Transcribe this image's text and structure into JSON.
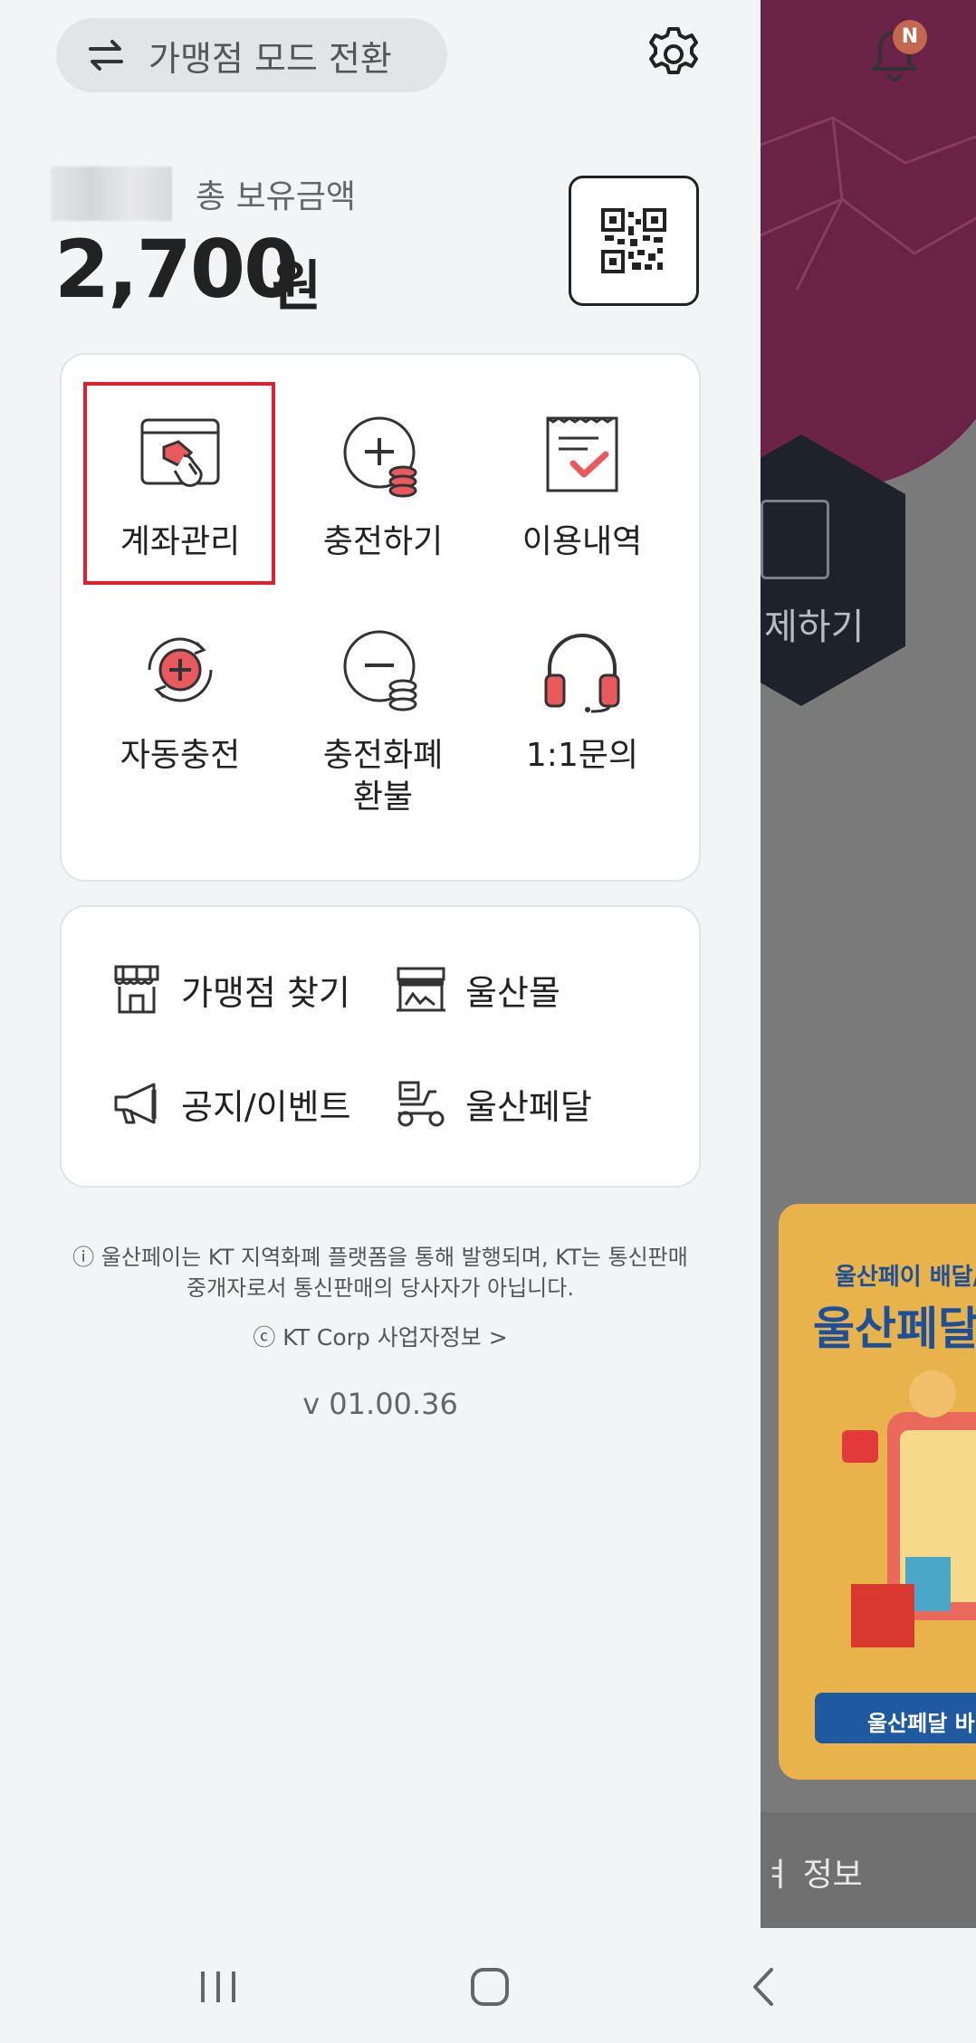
{
  "drawer": {
    "mode_switch_label": "가맹점 모드 전환",
    "asset": {
      "label": "총 보유금액",
      "amount": "2,700",
      "unit": "원"
    },
    "menu": [
      {
        "label": "계좌관리",
        "icon": "account-manage-icon"
      },
      {
        "label": "충전하기",
        "icon": "charge-icon"
      },
      {
        "label": "이용내역",
        "icon": "history-icon"
      },
      {
        "label": "자동충전",
        "icon": "auto-charge-icon"
      },
      {
        "label": "충전화폐\n환불",
        "icon": "refund-icon"
      },
      {
        "label": "1:1문의",
        "icon": "headset-icon"
      }
    ],
    "links": [
      {
        "label": "가맹점 찾기",
        "icon": "store-icon"
      },
      {
        "label": "울산몰",
        "icon": "mall-icon"
      },
      {
        "label": "공지/이벤트",
        "icon": "megaphone-icon"
      },
      {
        "label": "울산페달",
        "icon": "delivery-scooter-icon"
      }
    ],
    "notice_line1": "ⓘ 울산페이는 KT 지역화폐 플랫폼을 통해 발행되며, KT는 통신판매",
    "notice_line2": "중개자로서 통신판매의 당사자가 아닙니다.",
    "corp_info": "ⓒ KT Corp 사업자정보 >",
    "version": "v 01.00.36"
  },
  "background": {
    "notification_badge": "N",
    "pay_button_text": "제하기",
    "banner": {
      "line1": "울산페이 배달/",
      "line2": "울산페달",
      "button": "울산페달 바"
    },
    "bottom_text": "ㅕ 정보"
  },
  "colors": {
    "accent": "#e95a5f",
    "highlight": "#e0202e",
    "drawer_bg": "#f3f4f6"
  }
}
